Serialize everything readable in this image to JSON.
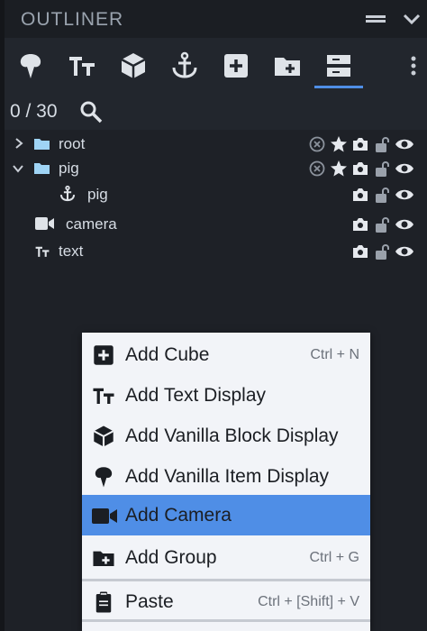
{
  "header": {
    "title": "OUTLINER"
  },
  "toolbar": {
    "icons": [
      "ice-cream-icon",
      "text-format-icon",
      "cube-icon",
      "anchor-icon",
      "add-box-icon",
      "add-folder-icon",
      "list-icon"
    ],
    "active": "list-icon"
  },
  "status": {
    "counter": "0 / 30"
  },
  "tree": {
    "rows": [
      {
        "label": "root",
        "icon": "folder-icon",
        "expanded": false,
        "actions": [
          "close-circle-icon",
          "star-icon",
          "camera-icon",
          "lock-open-icon",
          "eye-icon"
        ]
      },
      {
        "label": "pig",
        "icon": "folder-icon",
        "expanded": true,
        "actions": [
          "close-circle-icon",
          "star-icon",
          "camera-icon",
          "lock-open-icon",
          "eye-icon"
        ]
      },
      {
        "label": "pig",
        "icon": "anchor-icon",
        "actions": [
          "camera-icon",
          "lock-open-icon",
          "eye-icon"
        ]
      },
      {
        "label": "camera",
        "icon": "videocam-icon",
        "actions": [
          "camera-icon",
          "lock-open-icon",
          "eye-icon"
        ]
      },
      {
        "label": "text",
        "icon": "text-format-icon",
        "actions": [
          "camera-icon",
          "lock-open-icon",
          "eye-icon"
        ]
      }
    ]
  },
  "context_menu": {
    "items": [
      {
        "label": "Add Cube",
        "shortcut": "Ctrl + N",
        "icon": "add-box-icon"
      },
      {
        "label": "Add Text Display",
        "shortcut": "",
        "icon": "text-format-icon"
      },
      {
        "label": "Add Vanilla Block Display",
        "shortcut": "",
        "icon": "cube-icon"
      },
      {
        "label": "Add Vanilla Item Display",
        "shortcut": "",
        "icon": "ice-cream-icon"
      },
      {
        "label": "Add Camera",
        "shortcut": "",
        "icon": "videocam-icon",
        "highlighted": true
      },
      {
        "label": "Add Group",
        "shortcut": "Ctrl + G",
        "icon": "add-folder-icon"
      },
      {
        "label": "Paste",
        "shortcut": "Ctrl + [Shift] + V",
        "icon": "clipboard-icon"
      }
    ]
  },
  "colors": {
    "accent": "#4f8ee6",
    "background": "#1e2127",
    "menu_bg": "#f2f4f8",
    "folder": "#9fd4f5"
  }
}
